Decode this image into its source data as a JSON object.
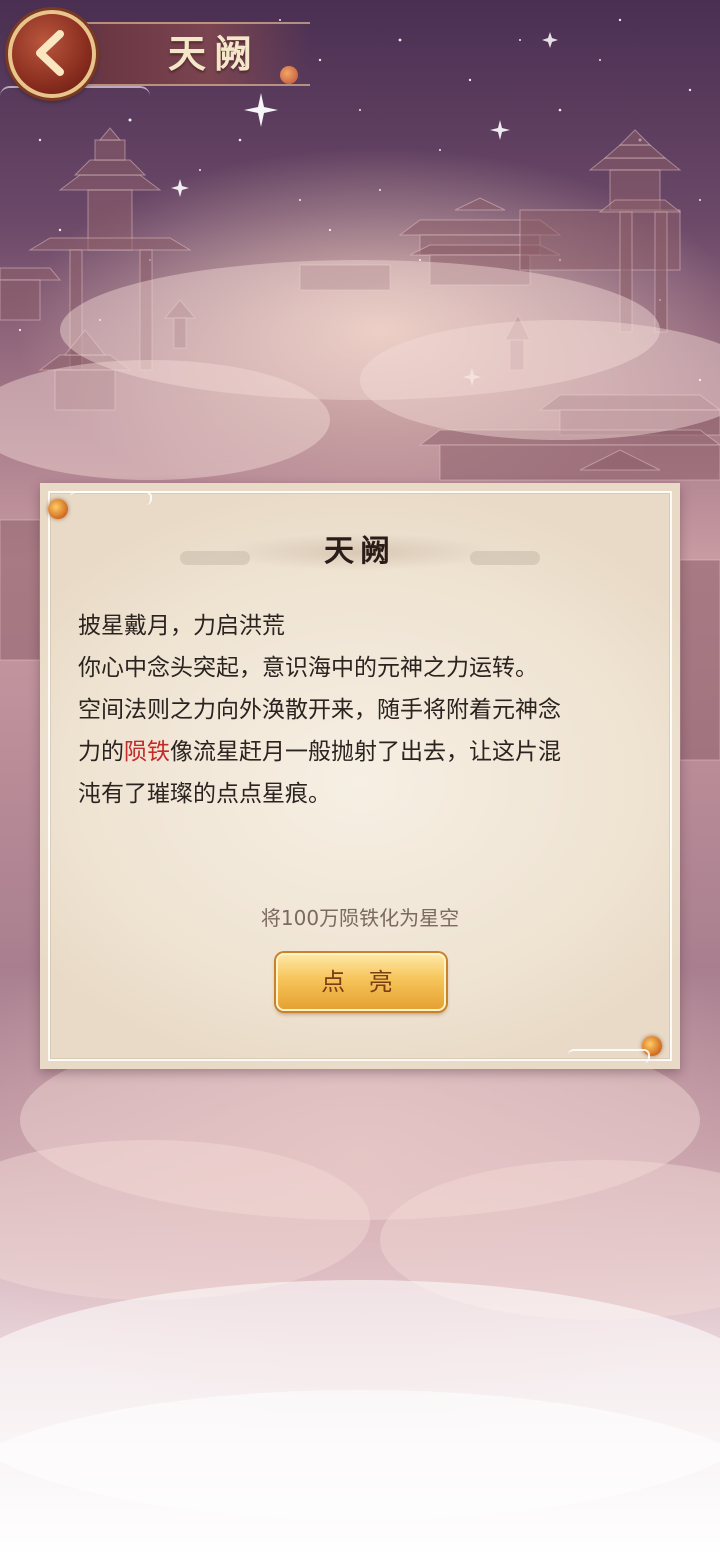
{
  "header": {
    "title": "天阙"
  },
  "panel": {
    "title": "天阙",
    "lines": {
      "line1": "披星戴月，力启洪荒",
      "line2": "你心中念头突起，意识海中的元神之力运转。",
      "line3": "空间法则之力向外涣散开来，随手将附着元神念",
      "line4_prefix": "力的",
      "line4_highlight": "陨铁",
      "line4_suffix": "像流星赶月一般抛射了出去，让这片混",
      "line5": "沌有了璀璨的点点星痕。"
    },
    "task_text": "将100万陨铁化为星空",
    "action_label": "点 亮"
  },
  "colors": {
    "highlight": "#c42a2a",
    "button_gold": "#f6c459",
    "panel_bg": "#efe3d2"
  },
  "icons": {
    "back": "chevron-left-icon"
  }
}
